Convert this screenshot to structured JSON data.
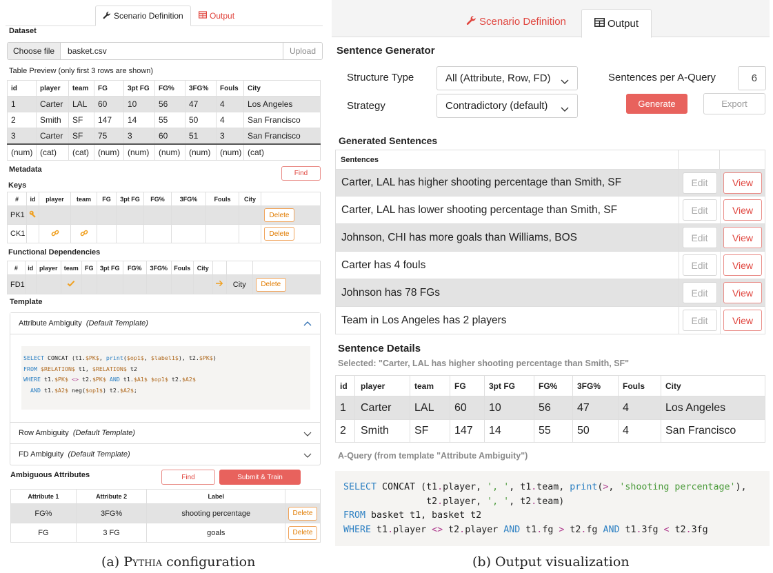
{
  "left": {
    "tabs": [
      {
        "label": "Scenario Definition",
        "icon": "wrench-icon"
      },
      {
        "label": "Output",
        "icon": "table-icon"
      }
    ],
    "dataset_label": "Dataset",
    "choose_file_label": "Choose file",
    "file_name": "basket.csv",
    "upload_label": "Upload",
    "table_preview_label": "Table Preview (only first 3 rows are shown)",
    "preview": {
      "headers": [
        "id",
        "player",
        "team",
        "FG",
        "3pt FG",
        "FG%",
        "3FG%",
        "Fouls",
        "City"
      ],
      "rows": [
        [
          "1",
          "Carter",
          "LAL",
          "60",
          "10",
          "56",
          "47",
          "4",
          "Los Angeles"
        ],
        [
          "2",
          "Smith",
          "SF",
          "147",
          "14",
          "55",
          "50",
          "4",
          "San Francisco"
        ],
        [
          "3",
          "Carter",
          "SF",
          "75",
          "3",
          "60",
          "51",
          "3",
          "San Francisco"
        ]
      ],
      "types": [
        "(num)",
        "(cat)",
        "(cat)",
        "(num)",
        "(num)",
        "(num)",
        "(num)",
        "(num)",
        "(cat)"
      ]
    },
    "metadata_label": "Metadata",
    "find_label": "Find",
    "keys_label": "Keys",
    "keys_headers": [
      "#",
      "id",
      "player",
      "team",
      "FG",
      "3pt FG",
      "FG%",
      "3FG%",
      "Fouls",
      "City"
    ],
    "keys_rows": [
      {
        "name": "PK1",
        "delete": "Delete"
      },
      {
        "name": "CK1",
        "delete": "Delete"
      }
    ],
    "fd_label": "Functional Dependencies",
    "fd_headers": [
      "#",
      "id",
      "player",
      "team",
      "FG",
      "3pt FG",
      "FG%",
      "3FG%",
      "Fouls",
      "City"
    ],
    "fd_rows": [
      {
        "name": "FD1",
        "target": "City",
        "delete": "Delete"
      }
    ],
    "template_label": "Template",
    "accordions": [
      {
        "title": "Attribute Ambiguity",
        "sub": "(Default Template)"
      },
      {
        "title": "Row Ambiguity",
        "sub": "(Default Template)"
      },
      {
        "title": "FD Ambiguity",
        "sub": "(Default Template)"
      }
    ],
    "ambiguous_label": "Ambiguous Attributes",
    "find2_label": "Find",
    "submit_label": "Submit & Train",
    "amb_headers": [
      "Attribute 1",
      "Attribute 2",
      "Label"
    ],
    "amb_rows": [
      {
        "a1": "FG%",
        "a2": "3FG%",
        "label": "shooting percentage",
        "delete": "Delete"
      },
      {
        "a1": "FG",
        "a2": "3 FG",
        "label": "goals",
        "delete": "Delete"
      }
    ],
    "caption_prefix": "(a) ",
    "caption_name": "Pythia",
    "caption_suffix": " configuration"
  },
  "right": {
    "tabs": [
      {
        "label": "Scenario Definition",
        "icon": "wrench-icon"
      },
      {
        "label": "Output",
        "icon": "table-icon"
      }
    ],
    "sentence_generator_label": "Sentence Generator",
    "structure_type_label": "Structure Type",
    "structure_type_value": "All (Attribute, Row, FD)",
    "strategy_label": "Strategy",
    "strategy_value": "Contradictory (default)",
    "sentences_per_label": "Sentences per A-Query",
    "sentences_per_value": "6",
    "generate_label": "Generate",
    "export_label": "Export",
    "generated_label": "Generated Sentences",
    "sentences_header": "Sentences",
    "sentences": [
      "Carter, LAL has higher shooting percentage than Smith, SF",
      "Carter, LAL has lower shooting percentage than Smith, SF",
      "Johnson, CHI has more goals than Williams, BOS",
      "Carter has 4 fouls",
      "Johnson has 78 FGs",
      "Team in Los Angeles has 2 players"
    ],
    "edit_label": "Edit",
    "view_label": "View",
    "details_label": "Sentence Details",
    "selected_text": "Selected: \"Carter, LAL has higher shooting percentage than Smith, SF\"",
    "details_headers": [
      "id",
      "player",
      "team",
      "FG",
      "3pt FG",
      "FG%",
      "3FG%",
      "Fouls",
      "City"
    ],
    "details_rows": [
      [
        "1",
        "Carter",
        "LAL",
        "60",
        "10",
        "56",
        "47",
        "4",
        "Los Angeles"
      ],
      [
        "2",
        "Smith",
        "SF",
        "147",
        "14",
        "55",
        "50",
        "4",
        "San Francisco"
      ]
    ],
    "aquery_label": "A-Query (from template \"Attribute Ambiguity\")",
    "caption": "(b) Output visualization"
  },
  "colors": {
    "accent_red": "#e8625d",
    "orange": "#f0a020",
    "code_bg": "#f5f4f2"
  }
}
